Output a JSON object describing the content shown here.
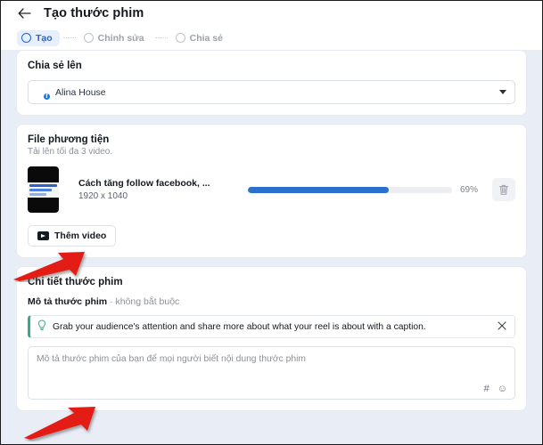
{
  "header": {
    "back_icon": "arrow-left-icon",
    "title": "Tạo thước phim"
  },
  "stepper": {
    "steps": [
      {
        "label": "Tạo",
        "active": true
      },
      {
        "label": "Chỉnh sửa",
        "active": false
      },
      {
        "label": "Chia sẻ",
        "active": false
      }
    ]
  },
  "share_to": {
    "title": "Chia sẻ lên",
    "selected": "Alina House",
    "badge": "f",
    "caret_icon": "chevron-down-icon"
  },
  "media": {
    "title": "File phương tiện",
    "subtitle": "Tải lên tối đa 3 video.",
    "item": {
      "name": "Cách tăng follow facebook, ...",
      "dimensions": "1920 x 1040",
      "progress_percent": 69,
      "progress_label": "69%",
      "delete_icon": "trash-icon"
    },
    "add_button": {
      "label": "Thêm video",
      "icon": "video-icon"
    }
  },
  "details": {
    "title": "Chi tiết thước phim",
    "description_label": "Mô tả thước phim",
    "description_optional": "· không bắt buộc",
    "tip": {
      "icon": "lightbulb-icon",
      "text": "Grab your audience's attention and share more about what your reel is about with a caption.",
      "close_icon": "close-icon"
    },
    "textarea_placeholder": "Mô tả thước phim của bạn để mọi người biết nội dung thước phim",
    "tools": [
      {
        "icon": "hashtag-icon",
        "glyph": "#"
      },
      {
        "icon": "emoji-icon",
        "glyph": "☺"
      }
    ]
  },
  "colors": {
    "accent_blue": "#1f65d6",
    "progress_blue": "#2b70cd",
    "facebook_blue": "#1877f2",
    "tip_green": "#3aa98a",
    "annotation_red": "#e41b17",
    "page_background": "#e9eef6"
  }
}
